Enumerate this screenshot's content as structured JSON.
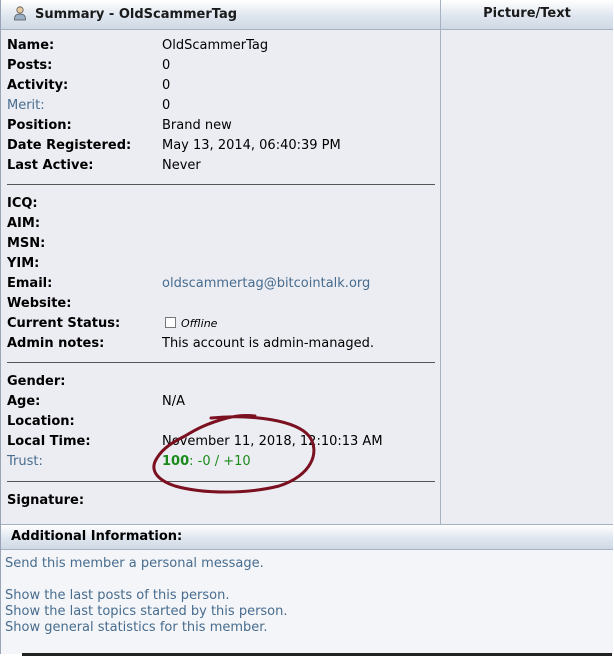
{
  "header": {
    "summary_title": "Summary - OldScammerTag",
    "picture_title": "Picture/Text"
  },
  "profile": {
    "name": {
      "label": "Name:",
      "value": "OldScammerTag"
    },
    "posts": {
      "label": "Posts:",
      "value": "0"
    },
    "activity": {
      "label": "Activity:",
      "value": "0"
    },
    "merit": {
      "label": "Merit:",
      "value": "0"
    },
    "position": {
      "label": "Position:",
      "value": "Brand new"
    },
    "date_registered": {
      "label": "Date Registered:",
      "value": "May 13, 2014, 06:40:39 PM"
    },
    "last_active": {
      "label": "Last Active:",
      "value": "Never"
    }
  },
  "contact": {
    "icq": {
      "label": "ICQ:"
    },
    "aim": {
      "label": "AIM:"
    },
    "msn": {
      "label": "MSN:"
    },
    "yim": {
      "label": "YIM:"
    },
    "email": {
      "label": "Email:",
      "value": "oldscammertag@bitcointalk.org"
    },
    "website": {
      "label": "Website:"
    },
    "current_status": {
      "label": "Current Status:",
      "value": "Offline"
    },
    "admin_notes": {
      "label": "Admin notes:",
      "value": "This account is admin-managed."
    }
  },
  "personal": {
    "gender": {
      "label": "Gender:"
    },
    "age": {
      "label": "Age:",
      "value": "N/A"
    },
    "location": {
      "label": "Location:"
    },
    "local_time": {
      "label": "Local Time:",
      "value": "November 11, 2018, 12:10:13 AM"
    },
    "trust": {
      "label": "Trust:",
      "score": "100",
      "detail": ": -0 / +10"
    }
  },
  "signature": {
    "label": "Signature:"
  },
  "additional": {
    "title": "Additional Information:",
    "send_pm": "Send this member a personal message.",
    "last_posts": "Show the last posts of this person.",
    "last_topics": "Show the last topics started by this person.",
    "statistics": "Show general statistics for this member."
  },
  "colors": {
    "link": "#476c8e",
    "trust_green": "#1a8a1a",
    "annotation_circle": "#7a1020",
    "panel_bg": "#ecedf3"
  },
  "icons": {
    "header_icon": "user-icon",
    "status_icon": "offline-checkbox-icon"
  }
}
